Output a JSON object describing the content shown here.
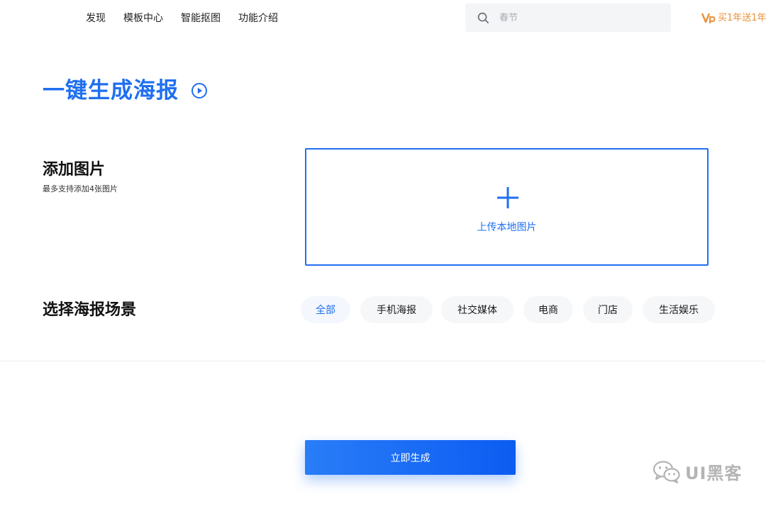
{
  "nav": {
    "items": [
      {
        "label": "发现"
      },
      {
        "label": "模板中心"
      },
      {
        "label": "智能抠图"
      },
      {
        "label": "功能介绍"
      }
    ]
  },
  "search": {
    "placeholder": "春节",
    "icon": "search-icon"
  },
  "promo": {
    "text": "买1年送1年",
    "icon": "vip-icon",
    "color": "#e8913a"
  },
  "headline": {
    "title": "一键生成海报",
    "icon": "play-circle-icon",
    "color": "#1f6ff0"
  },
  "add_images": {
    "title": "添加图片",
    "subtitle": "最多支持添加4张图片",
    "upload_label": "上传本地图片",
    "upload_icon": "plus-icon"
  },
  "scenes": {
    "title": "选择海报场景",
    "chips": [
      {
        "label": "全部",
        "active": true
      },
      {
        "label": "手机海报",
        "active": false
      },
      {
        "label": "社交媒体",
        "active": false
      },
      {
        "label": "电商",
        "active": false
      },
      {
        "label": "门店",
        "active": false
      },
      {
        "label": "生活娱乐",
        "active": false
      }
    ]
  },
  "generate_button": {
    "label": "立即生成"
  },
  "watermark": {
    "text": "UI黑客",
    "icon": "wechat-icon"
  },
  "colors": {
    "accent": "#1f6ff0",
    "promo": "#e8913a"
  }
}
